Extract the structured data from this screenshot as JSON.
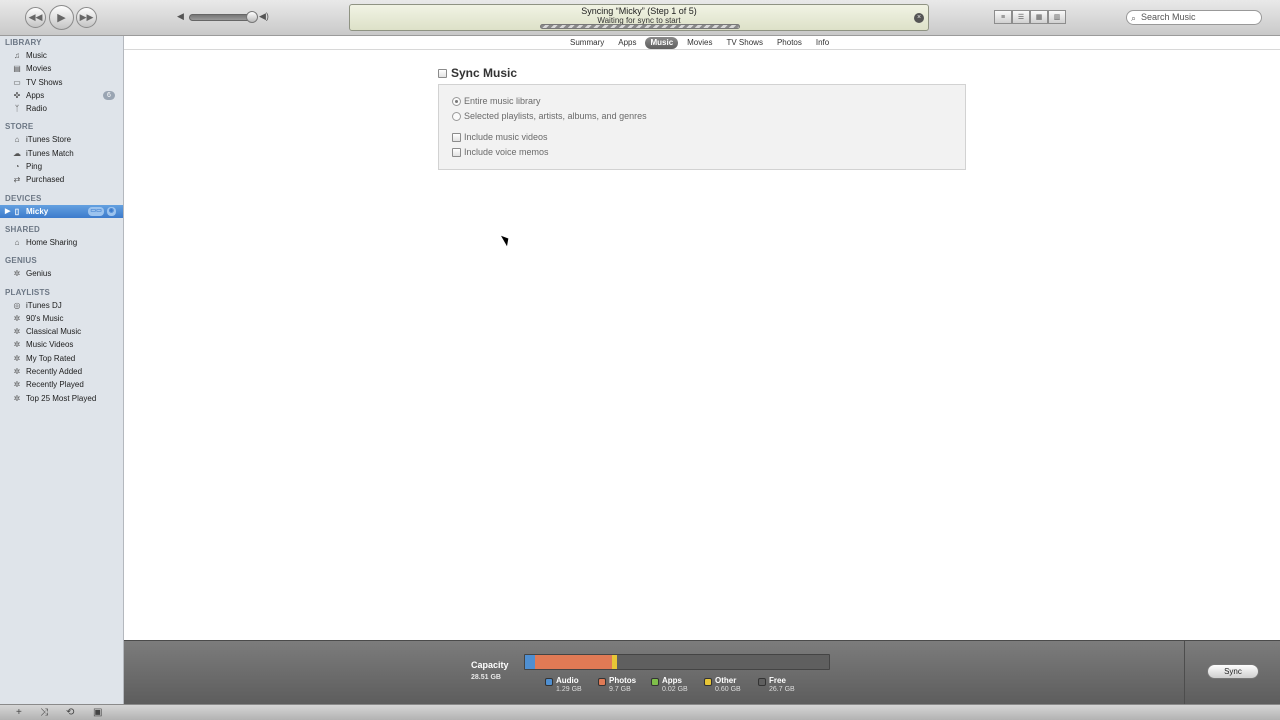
{
  "toolbar": {
    "rewind_icon": "◀◀",
    "play_icon": "▶",
    "ff_icon": "▶▶",
    "vol_low": "◀",
    "vol_high": "◀)",
    "status_title": "Syncing “Micky” (Step 1 of 5)",
    "status_sub": "Waiting for sync to start",
    "close_icon": "×",
    "view_icons": [
      "≡",
      "☰",
      "▦",
      "▥"
    ],
    "search_placeholder": "Search Music"
  },
  "sidebar": {
    "library": {
      "title": "LIBRARY",
      "items": [
        {
          "label": "Music",
          "icon": "♫"
        },
        {
          "label": "Movies",
          "icon": "▤"
        },
        {
          "label": "TV Shows",
          "icon": "▭"
        },
        {
          "label": "Apps",
          "icon": "✜",
          "badge": "6"
        },
        {
          "label": "Radio",
          "icon": "ᛉ"
        }
      ]
    },
    "store": {
      "title": "STORE",
      "items": [
        {
          "label": "iTunes Store",
          "icon": "⌂"
        },
        {
          "label": "iTunes Match",
          "icon": "☁"
        },
        {
          "label": "Ping",
          "icon": "◔"
        },
        {
          "label": "Purchased",
          "icon": "⇄"
        }
      ]
    },
    "devices": {
      "title": "DEVICES",
      "items": [
        {
          "label": "Micky",
          "icon": "▯",
          "arrow": "▶",
          "badge1": "▭▭",
          "badge2": "◉"
        }
      ]
    },
    "shared": {
      "title": "SHARED",
      "items": [
        {
          "label": "Home Sharing",
          "icon": "⌂"
        }
      ]
    },
    "genius": {
      "title": "GENIUS",
      "items": [
        {
          "label": "Genius",
          "icon": "✲"
        }
      ]
    },
    "playlists": {
      "title": "PLAYLISTS",
      "items": [
        {
          "label": "iTunes DJ",
          "icon": "◎"
        },
        {
          "label": "90's Music",
          "icon": "✲"
        },
        {
          "label": "Classical Music",
          "icon": "✲"
        },
        {
          "label": "Music Videos",
          "icon": "✲"
        },
        {
          "label": "My Top Rated",
          "icon": "✲"
        },
        {
          "label": "Recently Added",
          "icon": "✲"
        },
        {
          "label": "Recently Played",
          "icon": "✲"
        },
        {
          "label": "Top 25 Most Played",
          "icon": "✲"
        }
      ]
    }
  },
  "tabs": [
    "Summary",
    "Apps",
    "Music",
    "Movies",
    "TV Shows",
    "Photos",
    "Info"
  ],
  "selected_tab": "Music",
  "main": {
    "sync_title": "Sync Music",
    "opt_entire": "Entire music library",
    "opt_selected": "Selected playlists, artists, albums, and genres",
    "opt_videos": "Include music videos",
    "opt_memos": "Include voice memos"
  },
  "capacity": {
    "label": "Capacity",
    "size": "28.51 GB",
    "segments": [
      {
        "name": "Audio",
        "value": "1.29 GB",
        "gb": 1.29,
        "color": "#4f8fd1"
      },
      {
        "name": "Photos",
        "value": "9.7 GB",
        "gb": 9.7,
        "color": "#e07a55"
      },
      {
        "name": "Apps",
        "value": "0.02 GB",
        "gb": 0.02,
        "color": "#7fbf4a"
      },
      {
        "name": "Other",
        "value": "0.60 GB",
        "gb": 0.6,
        "color": "#e8c636"
      },
      {
        "name": "Free",
        "value": "26.7 GB",
        "gb": 26.7,
        "color": "#5f5f5f"
      }
    ],
    "sync_label": "Sync"
  },
  "bottombar": {
    "add_icon": "+",
    "shuffle_icon": "⤨",
    "repeat_icon": "⟲",
    "artwork_icon": "▣"
  }
}
